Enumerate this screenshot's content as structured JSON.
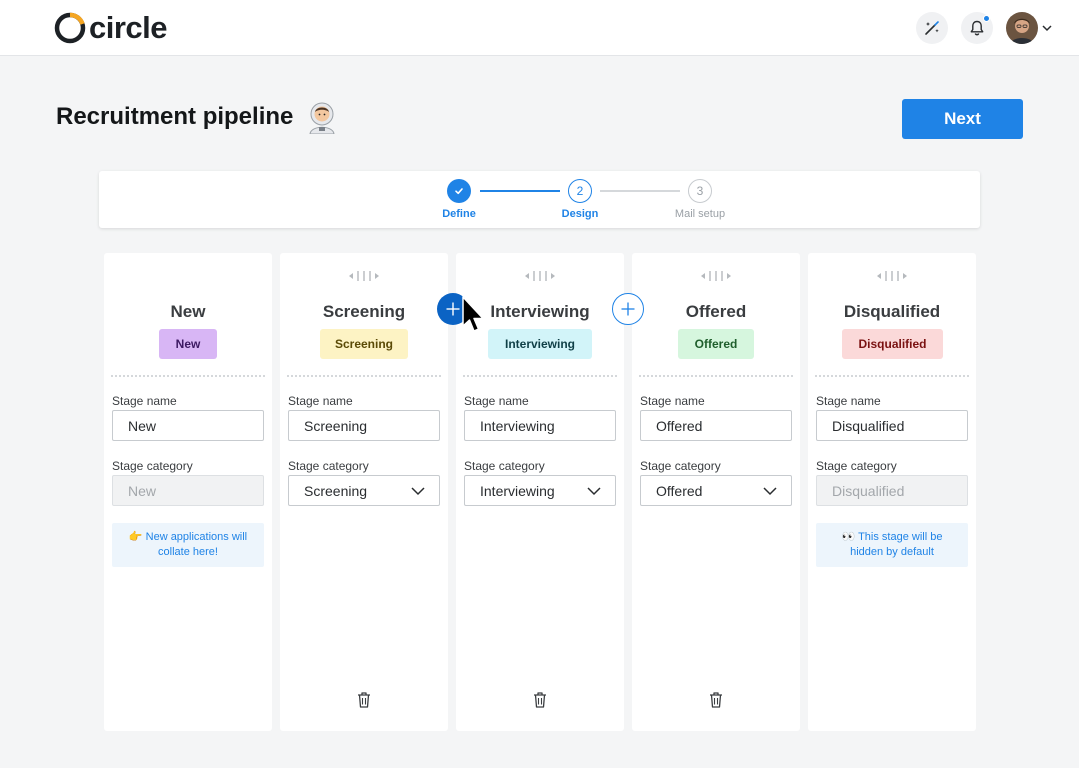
{
  "header": {
    "logo_text": "circle",
    "logo_accent_color": "#f5a623",
    "icons": [
      "magic-wand-icon",
      "bell-icon",
      "avatar",
      "chevron-down-icon"
    ],
    "notification_dot_color": "#1f83e6"
  },
  "page": {
    "title": "Recruitment pipeline",
    "title_emoji": "astronaut",
    "next_label": "Next"
  },
  "stepper": {
    "steps": [
      {
        "label": "Define",
        "number": "",
        "state": "done"
      },
      {
        "label": "Design",
        "number": "2",
        "state": "current"
      },
      {
        "label": "Mail setup",
        "number": "3",
        "state": "upcoming"
      }
    ]
  },
  "columns": [
    {
      "title": "New",
      "badge": "New",
      "badge_bg": "#d8b6f5",
      "badge_color": "#3d1a63",
      "stage_name_label": "Stage name",
      "stage_name_value": "New",
      "stage_category_label": "Stage category",
      "stage_category_value": "New",
      "category_disabled": true,
      "note": "👉 New applications will collate here!",
      "deletable": false,
      "draggable": false
    },
    {
      "title": "Screening",
      "badge": "Screening",
      "badge_bg": "#fdf3c4",
      "badge_color": "#5a4a06",
      "stage_name_label": "Stage name",
      "stage_name_value": "Screening",
      "stage_category_label": "Stage category",
      "stage_category_value": "Screening",
      "category_disabled": false,
      "note": "",
      "deletable": true,
      "draggable": true
    },
    {
      "title": "Interviewing",
      "badge": "Interviewing",
      "badge_bg": "#d2f4f9",
      "badge_color": "#0f3f47",
      "stage_name_label": "Stage name",
      "stage_name_value": "Interviewing",
      "stage_category_label": "Stage category",
      "stage_category_value": "Interviewing",
      "category_disabled": false,
      "note": "",
      "deletable": true,
      "draggable": true
    },
    {
      "title": "Offered",
      "badge": "Offered",
      "badge_bg": "#d6f6de",
      "badge_color": "#1f5e2c",
      "stage_name_label": "Stage name",
      "stage_name_value": "Offered",
      "stage_category_label": "Stage category",
      "stage_category_value": "Offered",
      "category_disabled": false,
      "note": "",
      "deletable": true,
      "draggable": true
    },
    {
      "title": "Disqualified",
      "badge": "Disqualified",
      "badge_bg": "#fbd9d9",
      "badge_color": "#7a1212",
      "stage_name_label": "Stage name",
      "stage_name_value": "Disqualified",
      "stage_category_label": "Stage category",
      "stage_category_value": "Disqualified",
      "category_disabled": true,
      "note": "👀 This stage will be hidden by default",
      "deletable": false,
      "draggable": true
    }
  ],
  "colors": {
    "accent": "#1f83e6",
    "accent_dark": "#0b63c4",
    "background": "#f4f5f6"
  }
}
